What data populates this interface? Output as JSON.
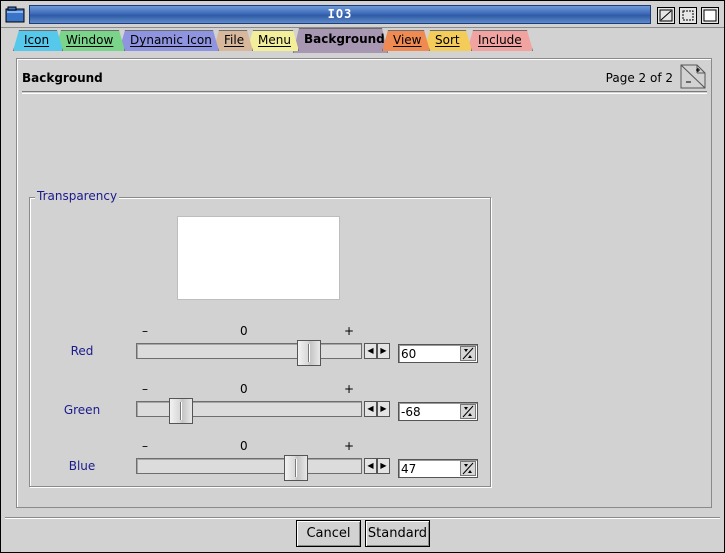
{
  "window": {
    "title": "IO3"
  },
  "tabs": [
    {
      "label": "Icon",
      "color": "#55c8ec"
    },
    {
      "label": "Window",
      "color": "#7ad48a"
    },
    {
      "label": "Dynamic Icon",
      "color": "#8f94e0"
    },
    {
      "label": "File",
      "color": "#d8b89c"
    },
    {
      "label": "Menu",
      "color": "#f2ee9a"
    },
    {
      "label": "Background",
      "color": "#a897b2",
      "active": true
    },
    {
      "label": "View",
      "color": "#ee8a52"
    },
    {
      "label": "Sort",
      "color": "#f3cc5a"
    },
    {
      "label": "Include",
      "color": "#f0a3a0"
    }
  ],
  "page": {
    "title": "Background",
    "info": "Page 2 of 2"
  },
  "transparency": {
    "label": "Transparency",
    "scale": {
      "min": "–",
      "mid": "0",
      "max": "+"
    },
    "range": [
      -100,
      100
    ],
    "channels": [
      {
        "label": "Red",
        "value": "60",
        "level": 60
      },
      {
        "label": "Green",
        "value": "-68",
        "level": -68
      },
      {
        "label": "Blue",
        "value": "47",
        "level": 47
      }
    ]
  },
  "buttons": {
    "cancel": "Cancel",
    "standard": "Standard"
  }
}
